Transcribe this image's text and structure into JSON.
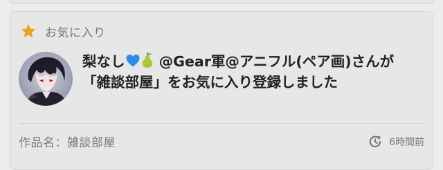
{
  "header": {
    "icon": "star-icon",
    "label": "お気に入り",
    "accent_color": "#f0a020"
  },
  "notification": {
    "user": {
      "name": "梨なし",
      "emoji": [
        "blue-heart-icon",
        "pear-icon"
      ],
      "handle": "@Gear軍@アニフル(ペア画)",
      "avatar": "avatar"
    },
    "line1_suffix": "さんが",
    "line2": "「雑談部屋」をお気に入り登録しました"
  },
  "footer": {
    "work_label": "作品名：雑談部屋",
    "time_icon": "history-icon",
    "time": "6時間前"
  }
}
